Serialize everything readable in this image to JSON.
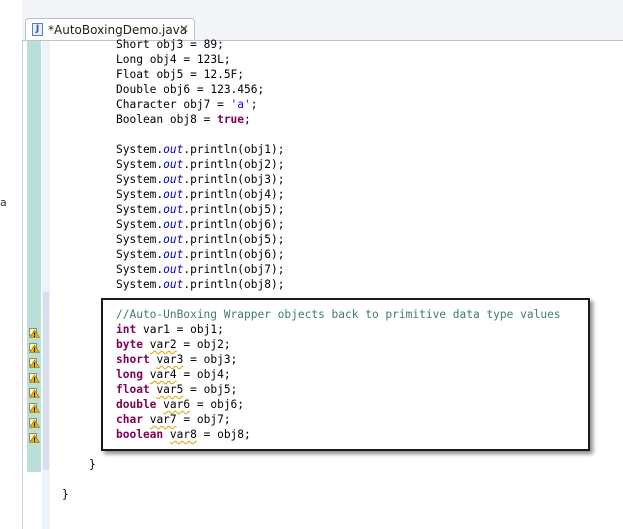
{
  "side_panel": {
    "glyph": "a"
  },
  "tab": {
    "icon_letter": "J",
    "title": "*AutoBoxingDemo.java",
    "close_glyph": "✕"
  },
  "code": {
    "decls": [
      {
        "type": "Short",
        "name": "obj3",
        "value": "89"
      },
      {
        "type": "Long",
        "name": "obj4",
        "value": "123L"
      },
      {
        "type": "Float",
        "name": "obj5",
        "value": "12.5F"
      },
      {
        "type": "Double",
        "name": "obj6",
        "value": "123.456"
      },
      {
        "type": "Character",
        "name": "obj7",
        "value": "'a'"
      },
      {
        "type": "Boolean",
        "name": "obj8",
        "value": "true"
      }
    ],
    "println": {
      "class": "System.",
      "field": "out",
      "method": ".println(",
      "args": [
        "obj1",
        "obj2",
        "obj3",
        "obj4",
        "obj5",
        "obj6",
        "obj5",
        "obj6",
        "obj7",
        "obj8"
      ]
    },
    "comment": "//Auto-UnBoxing Wrapper objects back to primitive data type values",
    "unboxing": [
      {
        "type": "int",
        "var": "var1",
        "obj": "obj1"
      },
      {
        "type": "byte",
        "var": "var2",
        "obj": "obj2"
      },
      {
        "type": "short",
        "var": "var3",
        "obj": "obj3"
      },
      {
        "type": "long",
        "var": "var4",
        "obj": "obj4"
      },
      {
        "type": "float",
        "var": "var5",
        "obj": "obj5"
      },
      {
        "type": "double",
        "var": "var6",
        "obj": "obj6"
      },
      {
        "type": "char",
        "var": "var7",
        "obj": "obj7"
      },
      {
        "type": "boolean",
        "var": "var8",
        "obj": "obj8"
      }
    ],
    "close_method": "}",
    "close_class": "}"
  },
  "colors": {
    "keyword": "#7f0055",
    "field": "#0000c0",
    "string": "#2a00ff",
    "comment": "#3f7f5f",
    "warning": "#e8b400"
  },
  "warning_icon": "warning-icon"
}
